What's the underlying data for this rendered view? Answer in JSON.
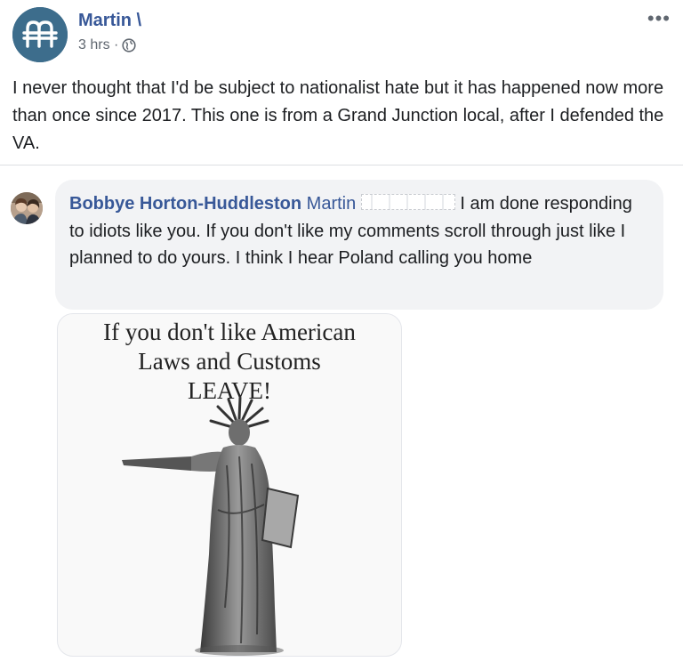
{
  "post": {
    "author": "Martin \\",
    "time": "3 hrs ·",
    "privacy_icon": "globe-icon",
    "more_icon": "more-options-icon",
    "text": "I never thought that I'd be subject to nationalist hate but it has happened now more than once since 2017. This one is from a Grand Junction local, after I defended the VA."
  },
  "comment": {
    "author": "Bobbye Horton-Huddleston",
    "mention": "Martin",
    "text": " I am done responding to idiots like you. If you don't like my comments scroll through just like I planned to do yours. I think I hear Poland calling you home",
    "image": {
      "caption_lines": [
        "If you don't like American",
        "Laws and Customs",
        "LEAVE!"
      ]
    }
  },
  "colors": {
    "link_blue": "#385898",
    "bubble_bg": "#f2f3f5",
    "secondary_text": "#606770"
  }
}
